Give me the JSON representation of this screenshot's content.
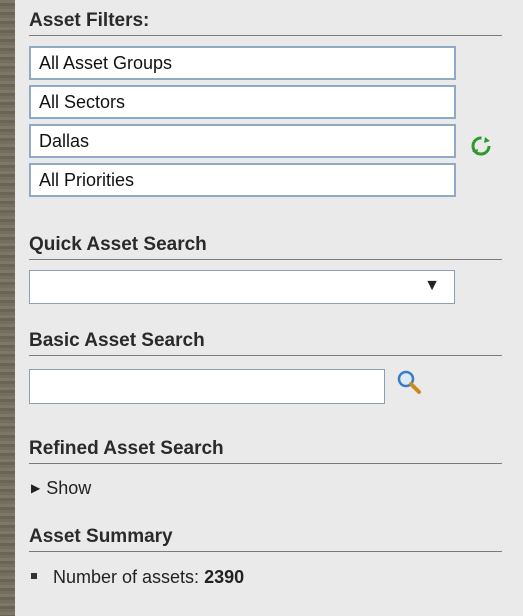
{
  "asset_filters": {
    "title": "Asset Filters:",
    "options": [
      "All Asset Groups",
      "All Sectors",
      "Dallas",
      "All Priorities"
    ]
  },
  "quick_search": {
    "title": "Quick Asset Search",
    "selected": ""
  },
  "basic_search": {
    "title": "Basic Asset Search",
    "value": ""
  },
  "refined_search": {
    "title": "Refined Asset Search",
    "toggle_label": "Show"
  },
  "summary": {
    "title": "Asset Summary",
    "count_label": "Number of assets:",
    "count_value": "2390"
  },
  "icons": {
    "refresh": "refresh-icon",
    "search": "magnifier-icon",
    "dropdown": "triangle-down-icon",
    "expand": "triangle-right-icon",
    "bullet": "square-bullet-icon"
  },
  "colors": {
    "panel_bg": "#eaeaea",
    "box_border": "#8fa9c6",
    "refresh_green": "#2e9a2e",
    "search_blue": "#3a7cc4"
  }
}
